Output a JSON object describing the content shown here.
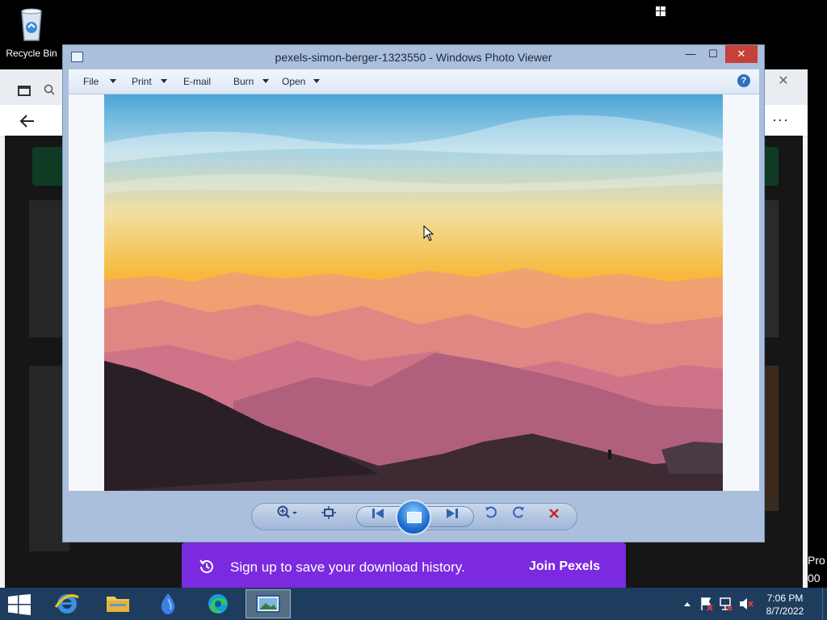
{
  "desktop": {
    "recycle_bin_label": "Recycle Bin"
  },
  "browser": {
    "back_icon": "back-arrow-icon",
    "more_label": "···",
    "close_label": "✕"
  },
  "viewer": {
    "title": "pexels-simon-berger-1323550 - Windows Photo Viewer",
    "min_label": "—",
    "max_label": "☐",
    "close_label": "✕",
    "menu": {
      "file": "File",
      "print": "Print",
      "email": "E-mail",
      "burn": "Burn",
      "open": "Open"
    },
    "help_label": "?",
    "controls": {
      "zoom_icon": "zoom-icon",
      "actual_size_icon": "actual-size-icon",
      "previous_icon": "previous-icon",
      "slideshow_icon": "slideshow-icon",
      "next_icon": "next-icon",
      "rotate_ccw_icon": "rotate-counterclockwise-icon",
      "rotate_cw_icon": "rotate-clockwise-icon",
      "delete_icon": "delete-icon"
    }
  },
  "banner": {
    "message": "Sign up to save your download history.",
    "action": "Join Pexels",
    "color": "#7b2ae0"
  },
  "edge": {
    "line1": "Pro",
    "line2": "00"
  },
  "taskbar": {
    "time": "7:06 PM",
    "date": "8/7/2022"
  },
  "colors": {
    "taskbar": "#1e3c5e",
    "viewer_frame": "#a9bfdc",
    "close_red": "#c7403a"
  }
}
